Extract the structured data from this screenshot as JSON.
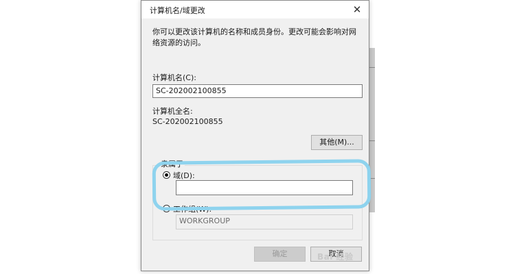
{
  "dialog": {
    "title": "计算机名/域更改",
    "close_glyph": "✕",
    "description": "你可以更改该计算机的名称和成员身份。更改可能会影响对网络资源的访问。",
    "computer_name_label": "计算机名(C):",
    "computer_name_value": "SC-202002100855",
    "full_name_label": "计算机全名:",
    "full_name_value": "SC-202002100855",
    "more_button": "其他(M)...",
    "member_of_label": "隶属于",
    "domain_radio_label": "域(D):",
    "domain_value": "",
    "workgroup_radio_label": "工作组(W):",
    "workgroup_value": "WORKGROUP",
    "ok_button": "确定",
    "cancel_button": "取消",
    "selected_option": "domain"
  },
  "watermark": "Bai 经验",
  "colors": {
    "highlight": "#8ed3ee",
    "dialog_bg": "#f0f0f0"
  }
}
